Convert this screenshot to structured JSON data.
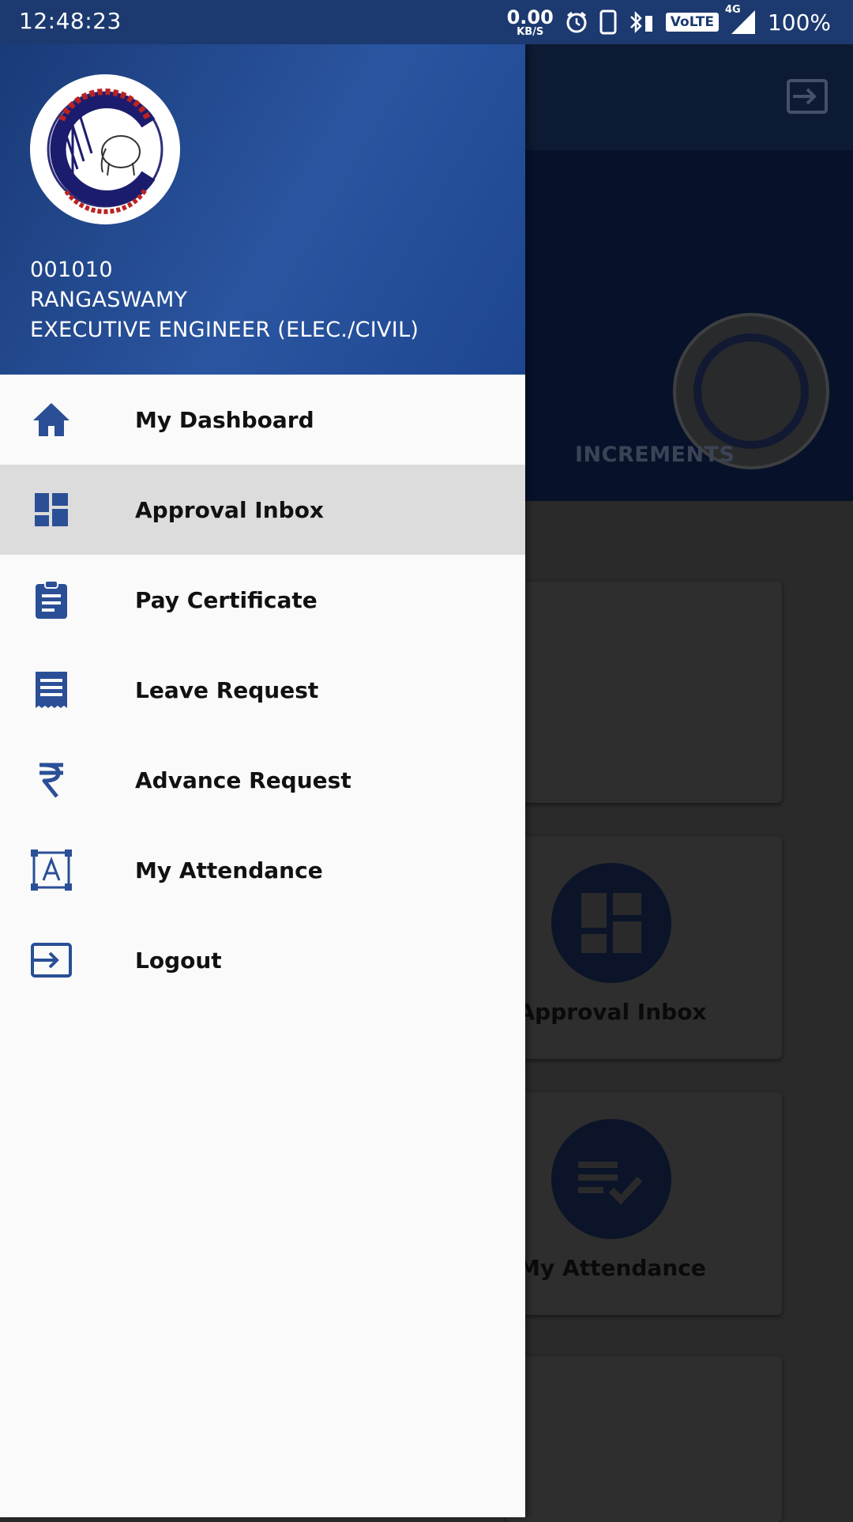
{
  "status_bar": {
    "time": "12:48:23",
    "net_speed": "0.00",
    "net_unit": "KB/S",
    "volte": "VoLTE",
    "network": "4G",
    "battery": "100%"
  },
  "background": {
    "tab_label": "INCREMENTS",
    "cards": [
      {
        "label": ""
      },
      {
        "label": "Approval Inbox",
        "icon": "dashboard-icon"
      },
      {
        "label": "My Attendance",
        "icon": "checklist-icon"
      }
    ]
  },
  "drawer": {
    "user": {
      "id": "001010",
      "name": "RANGASWAMY",
      "designation": "EXECUTIVE ENGINEER (ELEC./CIVIL)"
    },
    "logo": {
      "org": "C.E.S.C, MYSORE"
    },
    "menu": [
      {
        "label": "My Dashboard",
        "icon": "home-icon",
        "active": false
      },
      {
        "label": "Approval Inbox",
        "icon": "dashboard-icon",
        "active": true
      },
      {
        "label": "Pay Certificate",
        "icon": "clipboard-icon",
        "active": false
      },
      {
        "label": "Leave Request",
        "icon": "receipt-icon",
        "active": false
      },
      {
        "label": "Advance Request",
        "icon": "rupee-icon",
        "active": false
      },
      {
        "label": "My Attendance",
        "icon": "attendance-icon",
        "active": false
      },
      {
        "label": "Logout",
        "icon": "logout-icon",
        "active": false
      }
    ]
  },
  "colors": {
    "accent": "#2a4f96",
    "header_gradient_start": "#1a3a78",
    "header_gradient_end": "#2a55a0",
    "active_row": "#dcdcdc"
  }
}
